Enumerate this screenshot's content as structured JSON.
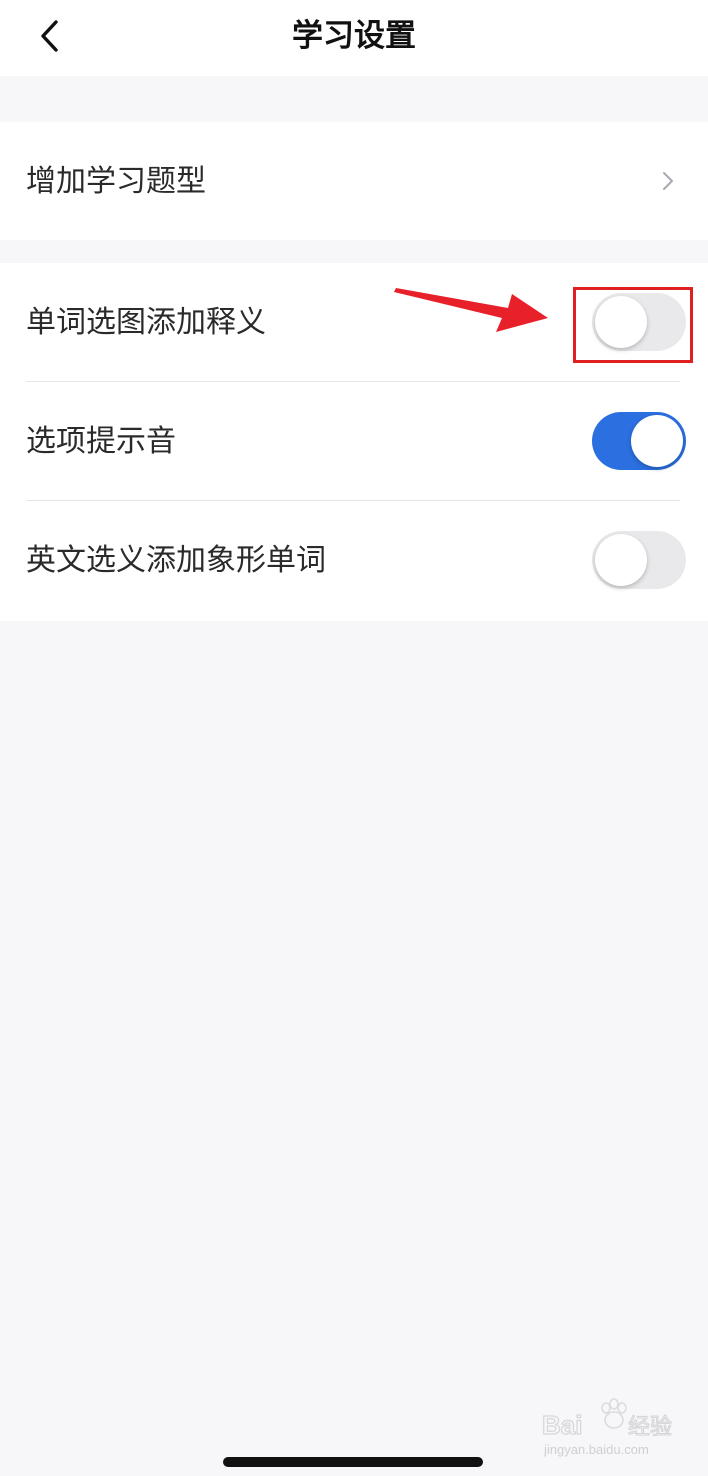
{
  "header": {
    "title": "学习设置",
    "back_icon": "chevron-left-icon"
  },
  "sections": [
    {
      "items": [
        {
          "label": "增加学习题型",
          "control": "chevron-right-icon"
        }
      ]
    },
    {
      "items": [
        {
          "label": "单词选图添加释义",
          "control": "toggle",
          "on": false,
          "highlighted": true
        },
        {
          "label": "选项提示音",
          "control": "toggle",
          "on": true
        },
        {
          "label": "英文选义添加象形单词",
          "control": "toggle",
          "on": false
        }
      ]
    }
  ],
  "annotation": {
    "highlight_color": "#e02020",
    "arrow_color": "#e8202a"
  },
  "colors": {
    "toggle_on": "#2b6fe0",
    "toggle_off": "#e9e9eb",
    "background": "#f7f7f9"
  },
  "watermark": {
    "brand": "Baidu",
    "suffix": "经验",
    "url": "jingyan.baidu.com"
  }
}
